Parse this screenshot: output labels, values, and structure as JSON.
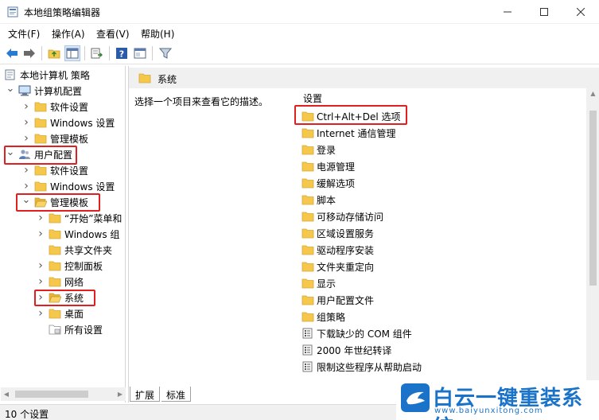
{
  "window": {
    "title": "本地组策略编辑器"
  },
  "menu": [
    "文件(F)",
    "操作(A)",
    "查看(V)",
    "帮助(H)"
  ],
  "tree": [
    {
      "label": "本地计算机 策略",
      "indent": 0,
      "arrow": "",
      "icon": "policy"
    },
    {
      "label": "计算机配置",
      "indent": 1,
      "arrow": "down",
      "icon": "computer"
    },
    {
      "label": "软件设置",
      "indent": 2,
      "arrow": "right",
      "icon": "folder"
    },
    {
      "label": "Windows 设置",
      "indent": 2,
      "arrow": "right",
      "icon": "folder"
    },
    {
      "label": "管理模板",
      "indent": 2,
      "arrow": "right",
      "icon": "folder"
    },
    {
      "label": "用户配置",
      "indent": 1,
      "arrow": "down",
      "icon": "user"
    },
    {
      "label": "软件设置",
      "indent": 2,
      "arrow": "right",
      "icon": "folder"
    },
    {
      "label": "Windows 设置",
      "indent": 2,
      "arrow": "right",
      "icon": "folder"
    },
    {
      "label": "管理模板",
      "indent": 2,
      "arrow": "down",
      "icon": "folder-open"
    },
    {
      "label": "“开始”菜单和",
      "indent": 3,
      "arrow": "right",
      "icon": "folder"
    },
    {
      "label": "Windows 组",
      "indent": 3,
      "arrow": "right",
      "icon": "folder"
    },
    {
      "label": "共享文件夹",
      "indent": 3,
      "arrow": "",
      "icon": "folder"
    },
    {
      "label": "控制面板",
      "indent": 3,
      "arrow": "right",
      "icon": "folder"
    },
    {
      "label": "网络",
      "indent": 3,
      "arrow": "right",
      "icon": "folder"
    },
    {
      "label": "系统",
      "indent": 3,
      "arrow": "right",
      "icon": "folder-open"
    },
    {
      "label": "桌面",
      "indent": 3,
      "arrow": "right",
      "icon": "folder"
    },
    {
      "label": "所有设置",
      "indent": 3,
      "arrow": "",
      "icon": "allsettings"
    }
  ],
  "detail": {
    "header": "系统",
    "description": "选择一个项目来查看它的描述。",
    "column": "设置",
    "items": [
      {
        "label": "Ctrl+Alt+Del 选项",
        "icon": "folder"
      },
      {
        "label": "Internet 通信管理",
        "icon": "folder"
      },
      {
        "label": "登录",
        "icon": "folder"
      },
      {
        "label": "电源管理",
        "icon": "folder"
      },
      {
        "label": "缓解选项",
        "icon": "folder"
      },
      {
        "label": "脚本",
        "icon": "folder"
      },
      {
        "label": "可移动存储访问",
        "icon": "folder"
      },
      {
        "label": "区域设置服务",
        "icon": "folder"
      },
      {
        "label": "驱动程序安装",
        "icon": "folder"
      },
      {
        "label": "文件夹重定向",
        "icon": "folder"
      },
      {
        "label": "显示",
        "icon": "folder"
      },
      {
        "label": "用户配置文件",
        "icon": "folder"
      },
      {
        "label": "组策略",
        "icon": "folder"
      },
      {
        "label": "下载缺少的 COM 组件",
        "icon": "setting"
      },
      {
        "label": "2000 年世纪转译",
        "icon": "setting"
      },
      {
        "label": "限制这些程序从帮助启动",
        "icon": "setting"
      }
    ]
  },
  "tabs": [
    "扩展",
    "标准"
  ],
  "status": "10 个设置",
  "watermark": {
    "title": "白云一键重装系统",
    "url": "www.baiyunxitong.com"
  },
  "colors": {
    "highlight": "#e02020",
    "folder": "#f5c84c",
    "accent": "#1a73c8"
  }
}
